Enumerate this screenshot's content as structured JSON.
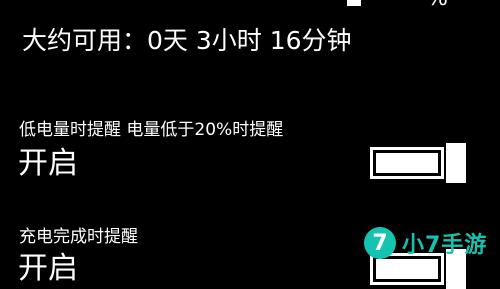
{
  "status": {
    "top_percent_fragment": "%"
  },
  "battery": {
    "estimate": "大约可用：0天 3小时 16分钟"
  },
  "settings": [
    {
      "title": "低电量时提醒   电量低于20%时提醒",
      "value": "开启",
      "toggle_on": true
    },
    {
      "title": "充电完成时提醒",
      "value": "开启",
      "toggle_on": true
    }
  ],
  "watermark": {
    "badge": "7",
    "text": "小7手游"
  },
  "colors": {
    "background": "#000000",
    "foreground": "#ffffff",
    "watermark": "#16c3b0"
  }
}
